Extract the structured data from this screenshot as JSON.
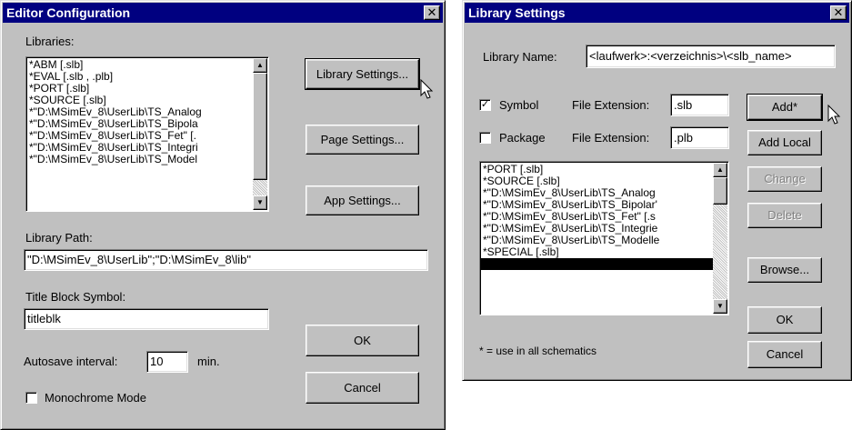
{
  "editor": {
    "title": "Editor Configuration",
    "close": "✕",
    "libraries_label": "Libraries:",
    "libraries": [
      "*ABM [.slb]",
      "*EVAL [.slb , .plb]",
      "*PORT [.slb]",
      "*SOURCE [.slb]",
      "*\"D:\\MSimEv_8\\UserLib\\TS_Analog",
      "*\"D:\\MSimEv_8\\UserLib\\TS_Bipola",
      "*\"D:\\MSimEv_8\\UserLib\\TS_Fet\" [.",
      "*\"D:\\MSimEv_8\\UserLib\\TS_Integri",
      "*\"D:\\MSimEv_8\\UserLib\\TS_Model"
    ],
    "library_settings_btn": "Library Settings...",
    "page_settings_btn": "Page Settings...",
    "app_settings_btn": "App Settings...",
    "library_path_label": "Library Path:",
    "library_path_value": "\"D:\\MSimEv_8\\UserLib\";\"D:\\MSimEv_8\\lib\"",
    "title_block_label": "Title Block Symbol:",
    "title_block_value": "titleblk",
    "autosave_label": "Autosave interval:",
    "autosave_value": "10",
    "autosave_unit": "min.",
    "ok_btn": "OK",
    "cancel_btn": "Cancel",
    "monochrome_label": "Monochrome Mode",
    "monochrome_checked": false
  },
  "library_settings": {
    "title": "Library Settings",
    "close": "✕",
    "library_name_label": "Library Name:",
    "library_name_value": "<laufwerk>:<verzeichnis>\\<slb_name>",
    "symbol_label": "Symbol",
    "symbol_checked": true,
    "symbol_ext_label": "File Extension:",
    "symbol_ext_value": ".slb",
    "package_label": "Package",
    "package_checked": false,
    "package_ext_label": "File Extension:",
    "package_ext_value": ".plb",
    "libraries": [
      "*PORT [.slb]",
      "*SOURCE [.slb]",
      "*\"D:\\MSimEv_8\\UserLib\\TS_Analog",
      "*\"D:\\MSimEv_8\\UserLib\\TS_Bipolar'",
      "*\"D:\\MSimEv_8\\UserLib\\TS_Fet\" [.s",
      "*\"D:\\MSimEv_8\\UserLib\\TS_Integrie",
      "*\"D:\\MSimEv_8\\UserLib\\TS_Modelle",
      "*SPECIAL [.slb]"
    ],
    "add_btn": "Add*",
    "add_local_btn": "Add Local",
    "change_btn": "Change",
    "delete_btn": "Delete",
    "browse_btn": "Browse...",
    "ok_btn": "OK",
    "cancel_btn": "Cancel",
    "footnote": "* = use in all schematics"
  },
  "colors": {
    "face": "#c0c0c0",
    "title_bar": "#000080",
    "selection": "#000000"
  }
}
